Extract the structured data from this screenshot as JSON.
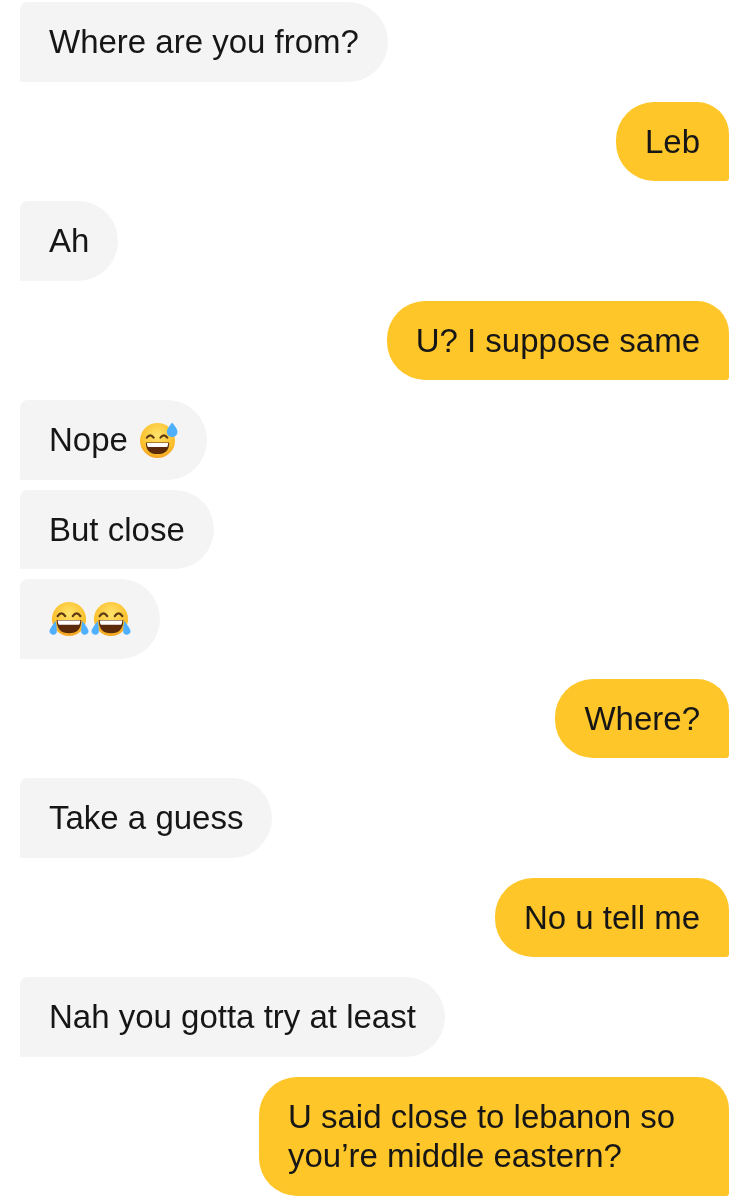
{
  "messages": [
    {
      "outgoing": false,
      "text": "Where are you from?"
    },
    {
      "outgoing": true,
      "text": "Leb"
    },
    {
      "outgoing": false,
      "text": "Ah"
    },
    {
      "outgoing": true,
      "text": "U? I suppose same"
    },
    {
      "outgoing": false,
      "text": "Nope",
      "emojis": [
        {
          "kind": "sweat"
        }
      ]
    },
    {
      "outgoing": false,
      "text": "But close"
    },
    {
      "outgoing": false,
      "emojis": [
        {
          "kind": "tears"
        },
        {
          "kind": "tears"
        }
      ]
    },
    {
      "outgoing": true,
      "text": "Where?"
    },
    {
      "outgoing": false,
      "text": "Take a guess"
    },
    {
      "outgoing": true,
      "text": "No u tell me"
    },
    {
      "outgoing": false,
      "text": "Nah you gotta try at least"
    },
    {
      "outgoing": true,
      "text": "U said close to lebanon so you’re middle eastern?"
    }
  ]
}
